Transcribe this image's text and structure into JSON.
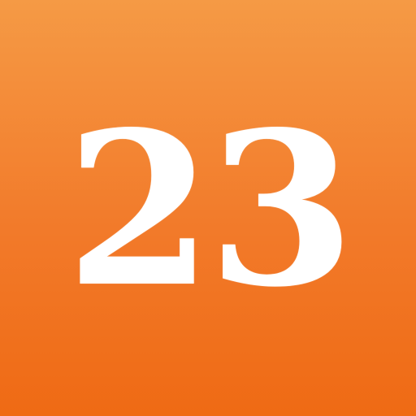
{
  "icon": {
    "number": "23",
    "colors": {
      "gradient_top": "#f59a45",
      "gradient_bottom": "#ef6a14",
      "text": "#ffffff"
    }
  }
}
